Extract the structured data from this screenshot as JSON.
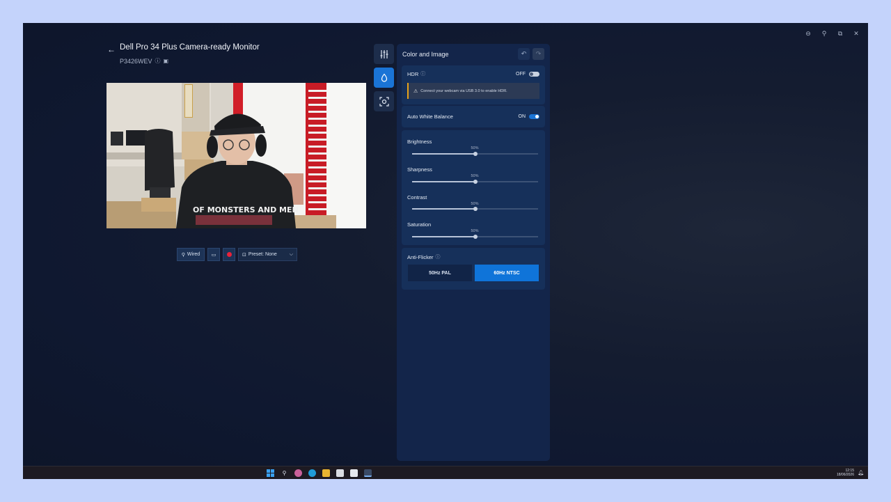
{
  "header": {
    "title": "Dell Pro 34 Plus Camera-ready Monitor",
    "model": "P3426WEV"
  },
  "window_controls": [
    "⊖",
    "⚲",
    "⧉",
    "✕"
  ],
  "toolbar": {
    "wired_label": "Wired",
    "preset_label": "Preset: None"
  },
  "panel": {
    "title": "Color and Image",
    "hdr": {
      "label": "HDR",
      "state": "OFF",
      "warning": "Connect your webcam via USB 3.0 to enable HDR."
    },
    "awb": {
      "label": "Auto White Balance",
      "state": "ON"
    },
    "sliders": [
      {
        "label": "Brightness",
        "value": "50%",
        "fraction": 0.5
      },
      {
        "label": "Sharpness",
        "value": "50%",
        "fraction": 0.5
      },
      {
        "label": "Contrast",
        "value": "50%",
        "fraction": 0.5
      },
      {
        "label": "Saturation",
        "value": "50%",
        "fraction": 0.5
      }
    ],
    "anti_flicker": {
      "label": "Anti-Flicker",
      "options": [
        "50Hz PAL",
        "60Hz NTSC"
      ],
      "selected": "60Hz NTSC"
    }
  },
  "taskbar": {
    "time": "12:15",
    "date": "18/06/2026"
  },
  "colors": {
    "accent": "#1a74d6",
    "warning": "#e6a21a",
    "record": "#e8223a"
  }
}
